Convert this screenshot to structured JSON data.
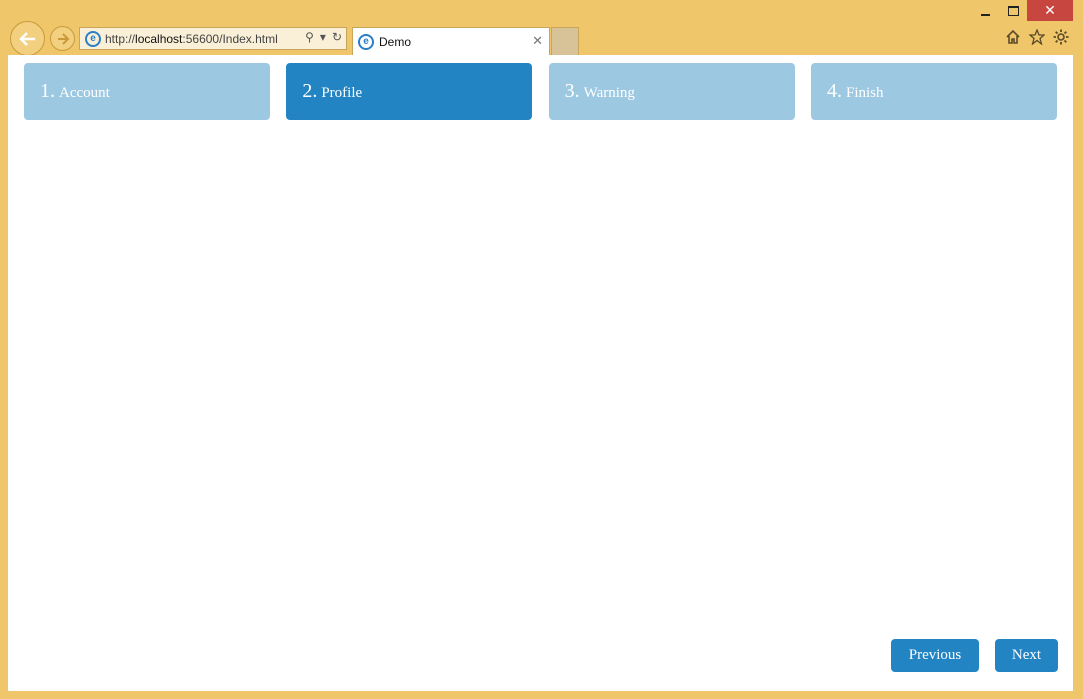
{
  "browser": {
    "url_prefix": "http://",
    "url_host": "localhost",
    "url_rest": ":56600/Index.html",
    "tab_title": "Demo",
    "icons": [
      "back-arrow-icon",
      "forward-arrow-icon",
      "search-icon",
      "refresh-icon",
      "home-icon",
      "favorites-star-icon",
      "settings-gear-icon"
    ]
  },
  "wizard": {
    "steps": [
      {
        "num": "1.",
        "label": "Account",
        "active": false
      },
      {
        "num": "2.",
        "label": "Profile",
        "active": true
      },
      {
        "num": "3.",
        "label": "Warning",
        "active": false
      },
      {
        "num": "4.",
        "label": "Finish",
        "active": false
      }
    ],
    "previous_label": "Previous",
    "next_label": "Next"
  },
  "colors": {
    "frame": "#f0c66a",
    "step_active": "#2384c3",
    "step_inactive": "#9dc8e2",
    "close_button": "#c7463f"
  }
}
